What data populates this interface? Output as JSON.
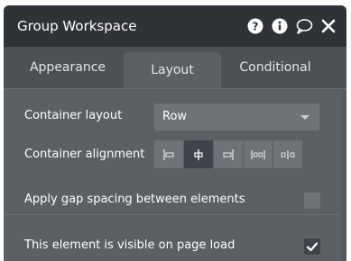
{
  "window": {
    "title": "Group Workspace"
  },
  "title_icons": [
    "help-icon",
    "info-icon",
    "comment-icon",
    "close-icon"
  ],
  "tabs": [
    {
      "label": "Appearance",
      "active": false
    },
    {
      "label": "Layout",
      "active": true
    },
    {
      "label": "Conditional",
      "active": false
    }
  ],
  "layout": {
    "container_layout": {
      "label": "Container layout",
      "value": "Row"
    },
    "container_alignment": {
      "label": "Container alignment",
      "options": [
        "align-left-icon",
        "align-center-icon",
        "align-right-icon",
        "space-between-icon",
        "space-around-icon"
      ],
      "selected_index": 1
    },
    "gap_spacing": {
      "label": "Apply gap spacing between elements",
      "checked": false
    },
    "visible_on_load": {
      "label": "This element is visible on page load",
      "checked": true
    }
  },
  "colors": {
    "titlebar": "#2f3337",
    "panel": "#5b6064",
    "control": "#6e7377",
    "control_active": "#40444a"
  }
}
